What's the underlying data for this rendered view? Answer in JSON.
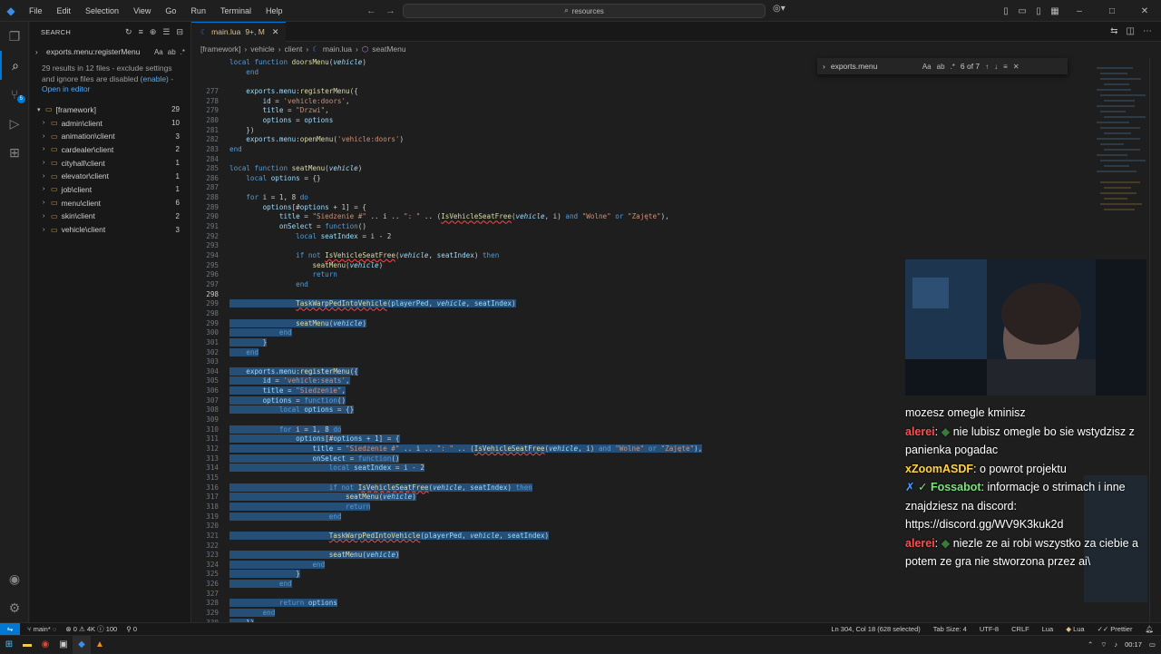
{
  "titlebar": {
    "menus": [
      "File",
      "Edit",
      "Selection",
      "View",
      "Go",
      "Run",
      "Terminal",
      "Help"
    ],
    "search_placeholder": "resources",
    "colors": {
      "accent": "#0078d4"
    }
  },
  "activity": {
    "search_badge": "5"
  },
  "sidebar": {
    "header": "SEARCH",
    "query": "exports.menu:registerMenu",
    "case_opt": "Aa",
    "results_msg_1": "29 results in 12 files - exclude settings and ignore files are disabled (",
    "enable_link": "enable",
    "results_msg_2": ") -",
    "open_in_editor": "Open in editor",
    "root": {
      "label": "[framework]",
      "count": "29"
    },
    "files": [
      {
        "label": "admin\\client",
        "count": "10"
      },
      {
        "label": "animation\\client",
        "count": "3"
      },
      {
        "label": "cardealer\\client",
        "count": "2"
      },
      {
        "label": "cityhall\\client",
        "count": "1"
      },
      {
        "label": "elevator\\client",
        "count": "1"
      },
      {
        "label": "job\\client",
        "count": "1"
      },
      {
        "label": "menu\\client",
        "count": "6"
      },
      {
        "label": "skin\\client",
        "count": "2"
      },
      {
        "label": "vehicle\\client",
        "count": "3"
      }
    ]
  },
  "editor": {
    "tab_label": "main.lua",
    "tab_status": "9+, M",
    "breadcrumb": [
      "[framework]",
      "vehicle",
      "client",
      "main.lua",
      "seatMenu"
    ],
    "find": {
      "value": "exports.menu",
      "case": "Aa",
      "count": "6 of 7"
    },
    "lines": [
      {
        "n": "",
        "t": "local function doorsMenu(vehicle)"
      },
      {
        "n": "",
        "t": "    end"
      },
      {
        "n": "",
        "t": ""
      },
      {
        "n": "277",
        "t": "    exports.menu:registerMenu({"
      },
      {
        "n": "278",
        "t": "        id = 'vehicle:doors',"
      },
      {
        "n": "279",
        "t": "        title = \"Drzwi\","
      },
      {
        "n": "280",
        "t": "        options = options"
      },
      {
        "n": "281",
        "t": "    })"
      },
      {
        "n": "282",
        "t": "    exports.menu:openMenu('vehicle:doors')"
      },
      {
        "n": "283",
        "t": "end"
      },
      {
        "n": "284",
        "t": ""
      },
      {
        "n": "285",
        "t": "local function seatMenu(vehicle)"
      },
      {
        "n": "286",
        "t": "    local options = {}"
      },
      {
        "n": "287",
        "t": ""
      },
      {
        "n": "288",
        "t": "    for i = 1, 8 do"
      },
      {
        "n": "289",
        "t": "        options[#options + 1] = {"
      },
      {
        "n": "290",
        "t": "            title = \"Siedzenie #\" .. i .. \": \" .. (IsVehicleSeatFree(vehicle, i) and \"Wolne\" or \"Zajęte\"),"
      },
      {
        "n": "291",
        "t": "            onSelect = function()"
      },
      {
        "n": "292",
        "t": "                local seatIndex = i - 2"
      },
      {
        "n": "293",
        "t": ""
      },
      {
        "n": "294",
        "t": "                if not IsVehicleSeatFree(vehicle, seatIndex) then"
      },
      {
        "n": "295",
        "t": "                    seatMenu(vehicle)"
      },
      {
        "n": "296",
        "t": "                    return"
      },
      {
        "n": "297",
        "t": "                end"
      },
      {
        "n": "298",
        "t": ""
      },
      {
        "n": "299",
        "t": "                TaskWarpPedIntoVehicle(playerPed, vehicle, seatIndex)"
      },
      {
        "n": "298",
        "t": ""
      },
      {
        "n": "299",
        "t": "                seatMenu(vehicle)"
      },
      {
        "n": "300",
        "t": "            end"
      },
      {
        "n": "301",
        "t": "        }"
      },
      {
        "n": "302",
        "t": "    end"
      },
      {
        "n": "303",
        "t": ""
      },
      {
        "n": "304",
        "t": "    exports.menu:registerMenu({"
      },
      {
        "n": "305",
        "t": "        id = 'vehicle:seats',"
      },
      {
        "n": "306",
        "t": "        title = \"Siedzenie\","
      },
      {
        "n": "307",
        "t": "        options = function()"
      },
      {
        "n": "308",
        "t": "            local options = {}"
      },
      {
        "n": "309",
        "t": ""
      },
      {
        "n": "310",
        "t": "            for i = 1, 8 do"
      },
      {
        "n": "311",
        "t": "                options[#options + 1] = {"
      },
      {
        "n": "312",
        "t": "                    title = \"Siedzenie #\" .. i .. \": \" .. (IsVehicleSeatFree(vehicle, i) and \"Wolne\" or \"Zajęte\"),"
      },
      {
        "n": "313",
        "t": "                    onSelect = function()"
      },
      {
        "n": "314",
        "t": "                        local seatIndex = i - 2"
      },
      {
        "n": "315",
        "t": ""
      },
      {
        "n": "316",
        "t": "                        if not IsVehicleSeatFree(vehicle, seatIndex) then"
      },
      {
        "n": "317",
        "t": "                            seatMenu(vehicle)"
      },
      {
        "n": "318",
        "t": "                            return"
      },
      {
        "n": "319",
        "t": "                        end"
      },
      {
        "n": "320",
        "t": ""
      },
      {
        "n": "321",
        "t": "                        TaskWarpPedIntoVehicle(playerPed, vehicle, seatIndex)"
      },
      {
        "n": "322",
        "t": ""
      },
      {
        "n": "323",
        "t": "                        seatMenu(vehicle)"
      },
      {
        "n": "324",
        "t": "                    end"
      },
      {
        "n": "325",
        "t": "                }"
      },
      {
        "n": "326",
        "t": "            end"
      },
      {
        "n": "327",
        "t": ""
      },
      {
        "n": "328",
        "t": "            return options"
      },
      {
        "n": "329",
        "t": "        end"
      },
      {
        "n": "330",
        "t": "    })"
      }
    ],
    "current_line": "298"
  },
  "chat": [
    {
      "user": "",
      "text": "mozesz omegle kminisz"
    },
    {
      "user": "alerei",
      "color": "red",
      "text": "nie lubisz omegle bo sie wstydzisz z panienka pogadac"
    },
    {
      "user": "xZoomASDF",
      "color": "gold",
      "text": "o powrot projektu"
    },
    {
      "user": "Fossabot",
      "color": "green",
      "text": "informacje o strimach i inne znajdziesz na discord: https://discord.gg/WV9K3kuk2d"
    },
    {
      "user": "alerei",
      "color": "red",
      "text": "niezle ze ai robi wszystko za ciebie a potem ze gra nie stworzona przez ai\\"
    }
  ],
  "statusbar": {
    "branch": "main*",
    "problems": "0",
    "warnings": "4K",
    "info": "100",
    "ports": "0",
    "position": "Ln 304, Col 18 (628 selected)",
    "tab_size": "Tab Size: 4",
    "encoding": "UTF-8",
    "eol": "CRLF",
    "language": "Lua",
    "lang2": "Lua",
    "formatter": "Prettier"
  },
  "taskbar": {
    "time": "00:17"
  }
}
